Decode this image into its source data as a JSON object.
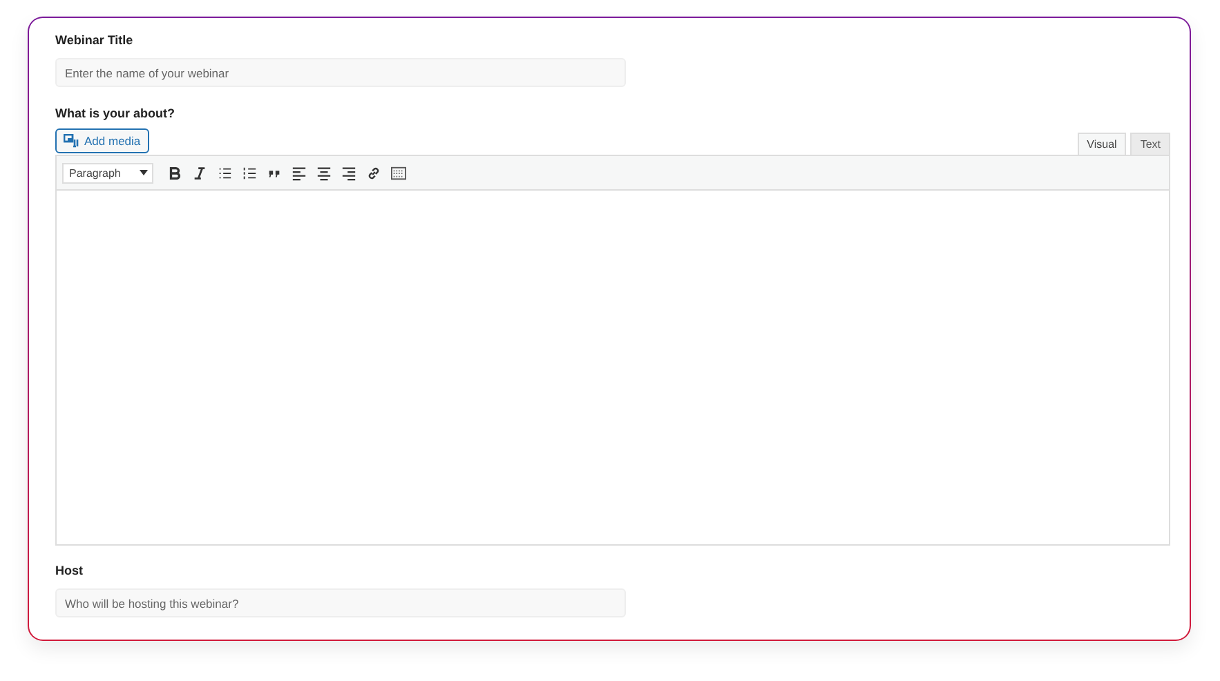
{
  "title_field": {
    "label": "Webinar Title",
    "placeholder": "Enter the name of your webinar"
  },
  "about": {
    "label": "What is your about?",
    "add_media": "Add media",
    "tabs": [
      {
        "label": "Visual",
        "selected": true
      },
      {
        "label": "Text",
        "selected": false
      }
    ],
    "format_select": "Paragraph"
  },
  "host_field": {
    "label": "Host",
    "placeholder": "Who will be hosting this webinar?"
  }
}
